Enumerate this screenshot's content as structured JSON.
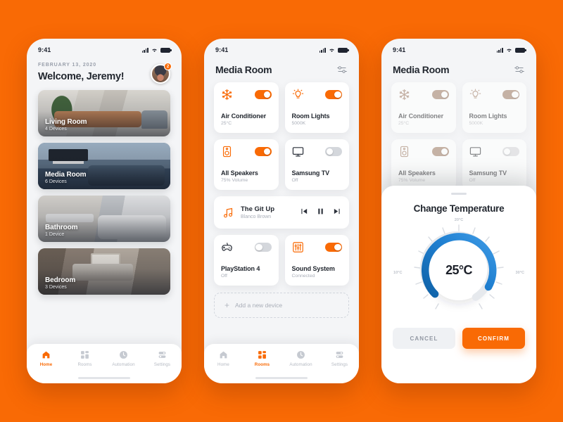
{
  "theme": {
    "background": "#F96A05",
    "accent": "#F96A05",
    "card": "#FFFFFF",
    "screen_bg": "#F4F5F7",
    "dial_active": "#1F7FD0",
    "dial_track": "#E6E9ED"
  },
  "status_bar": {
    "time": "9:41",
    "signal_icon": "cellular-bars-icon",
    "wifi_icon": "wifi-icon",
    "battery_icon": "battery-icon"
  },
  "screen1": {
    "date": "FEBRUARY 13, 2020",
    "welcome": "Welcome, Jeremy!",
    "avatar_badge": "2",
    "rooms": [
      {
        "name": "Living Room",
        "devices": "4 Devices",
        "photo": "ph-living"
      },
      {
        "name": "Media Room",
        "devices": "6 Devices",
        "photo": "ph-media"
      },
      {
        "name": "Bathroom",
        "devices": "1 Device",
        "photo": "ph-bath"
      },
      {
        "name": "Bedroom",
        "devices": "3 Devices",
        "photo": "ph-bed"
      }
    ],
    "tabs": [
      {
        "label": "Home",
        "icon": "home-icon",
        "active": true
      },
      {
        "label": "Rooms",
        "icon": "rooms-grid-icon",
        "active": false
      },
      {
        "label": "Automation",
        "icon": "clock-icon",
        "active": false
      },
      {
        "label": "Settings",
        "icon": "sliders-icon",
        "active": false
      }
    ]
  },
  "screen2": {
    "title": "Media Room",
    "filter_icon": "filter-sliders-icon",
    "devices": [
      {
        "name": "Air Conditioner",
        "status": "25°C",
        "icon": "snowflake-icon",
        "on": true
      },
      {
        "name": "Room Lights",
        "status": "5000K",
        "icon": "lightbulb-icon",
        "on": true
      },
      {
        "name": "All Speakers",
        "status": "75% Volume",
        "icon": "speaker-icon",
        "on": true
      },
      {
        "name": "Samsung TV",
        "status": "Off",
        "icon": "tv-icon",
        "on": false
      },
      {
        "name": "PlayStation 4",
        "status": "Off",
        "icon": "gamepad-icon",
        "on": false
      },
      {
        "name": "Sound System",
        "status": "Connected",
        "icon": "equalizer-icon",
        "on": true
      }
    ],
    "player": {
      "icon": "music-note-icon",
      "track": "The Git Up",
      "artist": "Blanco Brown",
      "prev_icon": "previous-track-icon",
      "pause_icon": "pause-icon",
      "next_icon": "next-track-icon"
    },
    "add_device": {
      "plus_icon": "plus-icon",
      "label": "Add a new device"
    },
    "tabs": [
      {
        "label": "Home",
        "icon": "home-icon",
        "active": false
      },
      {
        "label": "Rooms",
        "icon": "rooms-grid-icon",
        "active": true
      },
      {
        "label": "Automation",
        "icon": "clock-icon",
        "active": false
      },
      {
        "label": "Settings",
        "icon": "sliders-icon",
        "active": false
      }
    ]
  },
  "screen3": {
    "title": "Media Room",
    "filter_icon": "filter-sliders-icon",
    "devices": [
      {
        "name": "Air Conditioner",
        "status": "25°C",
        "icon": "snowflake-icon",
        "on": true
      },
      {
        "name": "Room Lights",
        "status": "5000K",
        "icon": "lightbulb-icon",
        "on": true
      },
      {
        "name": "All Speakers",
        "status": "75% Volume",
        "icon": "speaker-icon",
        "on": true
      },
      {
        "name": "Samsung TV",
        "status": "Off",
        "icon": "tv-icon",
        "on": false
      }
    ],
    "sheet": {
      "title": "Change Temperature",
      "value": "25°C",
      "ticks": {
        "min": "10°C",
        "mid": "20°C",
        "max": "30°C"
      },
      "cancel_label": "CANCEL",
      "confirm_label": "CONFIRM"
    }
  },
  "chart_data": {
    "type": "gauge",
    "title": "Change Temperature",
    "value": 25,
    "unit": "°C",
    "min": 10,
    "max": 30,
    "tick_labels": [
      "10°C",
      "20°C",
      "30°C"
    ],
    "arc_start_deg": 225,
    "arc_end_deg": 60,
    "active_color": "#1F7FD0",
    "track_color": "#E6E9ED"
  }
}
